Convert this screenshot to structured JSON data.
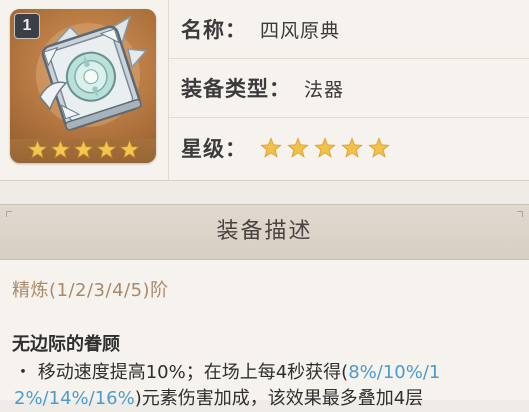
{
  "item": {
    "refine_badge": "1",
    "rarity_stars": 5,
    "icon": "catalyst-book-icon"
  },
  "info": {
    "name_label": "名称",
    "name_value": "四风原典",
    "type_label": "装备类型",
    "type_value": "法器",
    "rarity_label": "星级",
    "colon": "："
  },
  "description": {
    "header": "装备描述",
    "refine_levels": "精炼(1/2/3/4/5)阶",
    "passive_name": "无边际的眷顾",
    "line1_prefix": "・ 移动速度提高10%；在场上每4秒获得(",
    "line1_highlight": "8%/10%/1",
    "line2_highlight": "2%/14%/16%",
    "line2_suffix": ")元素伤害加成，该效果最多叠加4层"
  },
  "colors": {
    "star": "#f2c14a",
    "highlight": "#4a9ccc",
    "refine_text": "#a78a6b",
    "card_bg": "#a5703d"
  }
}
